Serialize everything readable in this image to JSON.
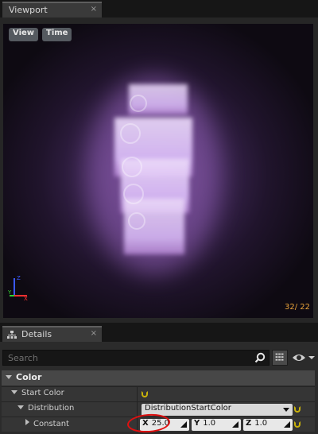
{
  "viewport_tab": {
    "label": "Viewport",
    "close": "×"
  },
  "viewport": {
    "view_button": "View",
    "time_button": "Time",
    "frame_counter": "32/ 22",
    "axis_labels": {
      "z": "Z",
      "y": "Y",
      "x": "X"
    }
  },
  "details_tab": {
    "label": "Details",
    "close": "×"
  },
  "details": {
    "search_placeholder": "Search",
    "category": "Color",
    "rows": {
      "start_color": "Start Color",
      "distribution": "Distribution",
      "distribution_value": "DistributionStartColor",
      "constant": "Constant"
    },
    "vector": {
      "x_label": "X",
      "x_value": "25.0",
      "y_label": "Y",
      "y_value": "1.0",
      "z_label": "Z",
      "z_value": "1.0"
    }
  },
  "colors": {
    "accent_reset": "#c9b20a",
    "frame_counter": "#e8a23a",
    "annotation": "#e01010",
    "particle_glow": "#d9a8ff"
  }
}
